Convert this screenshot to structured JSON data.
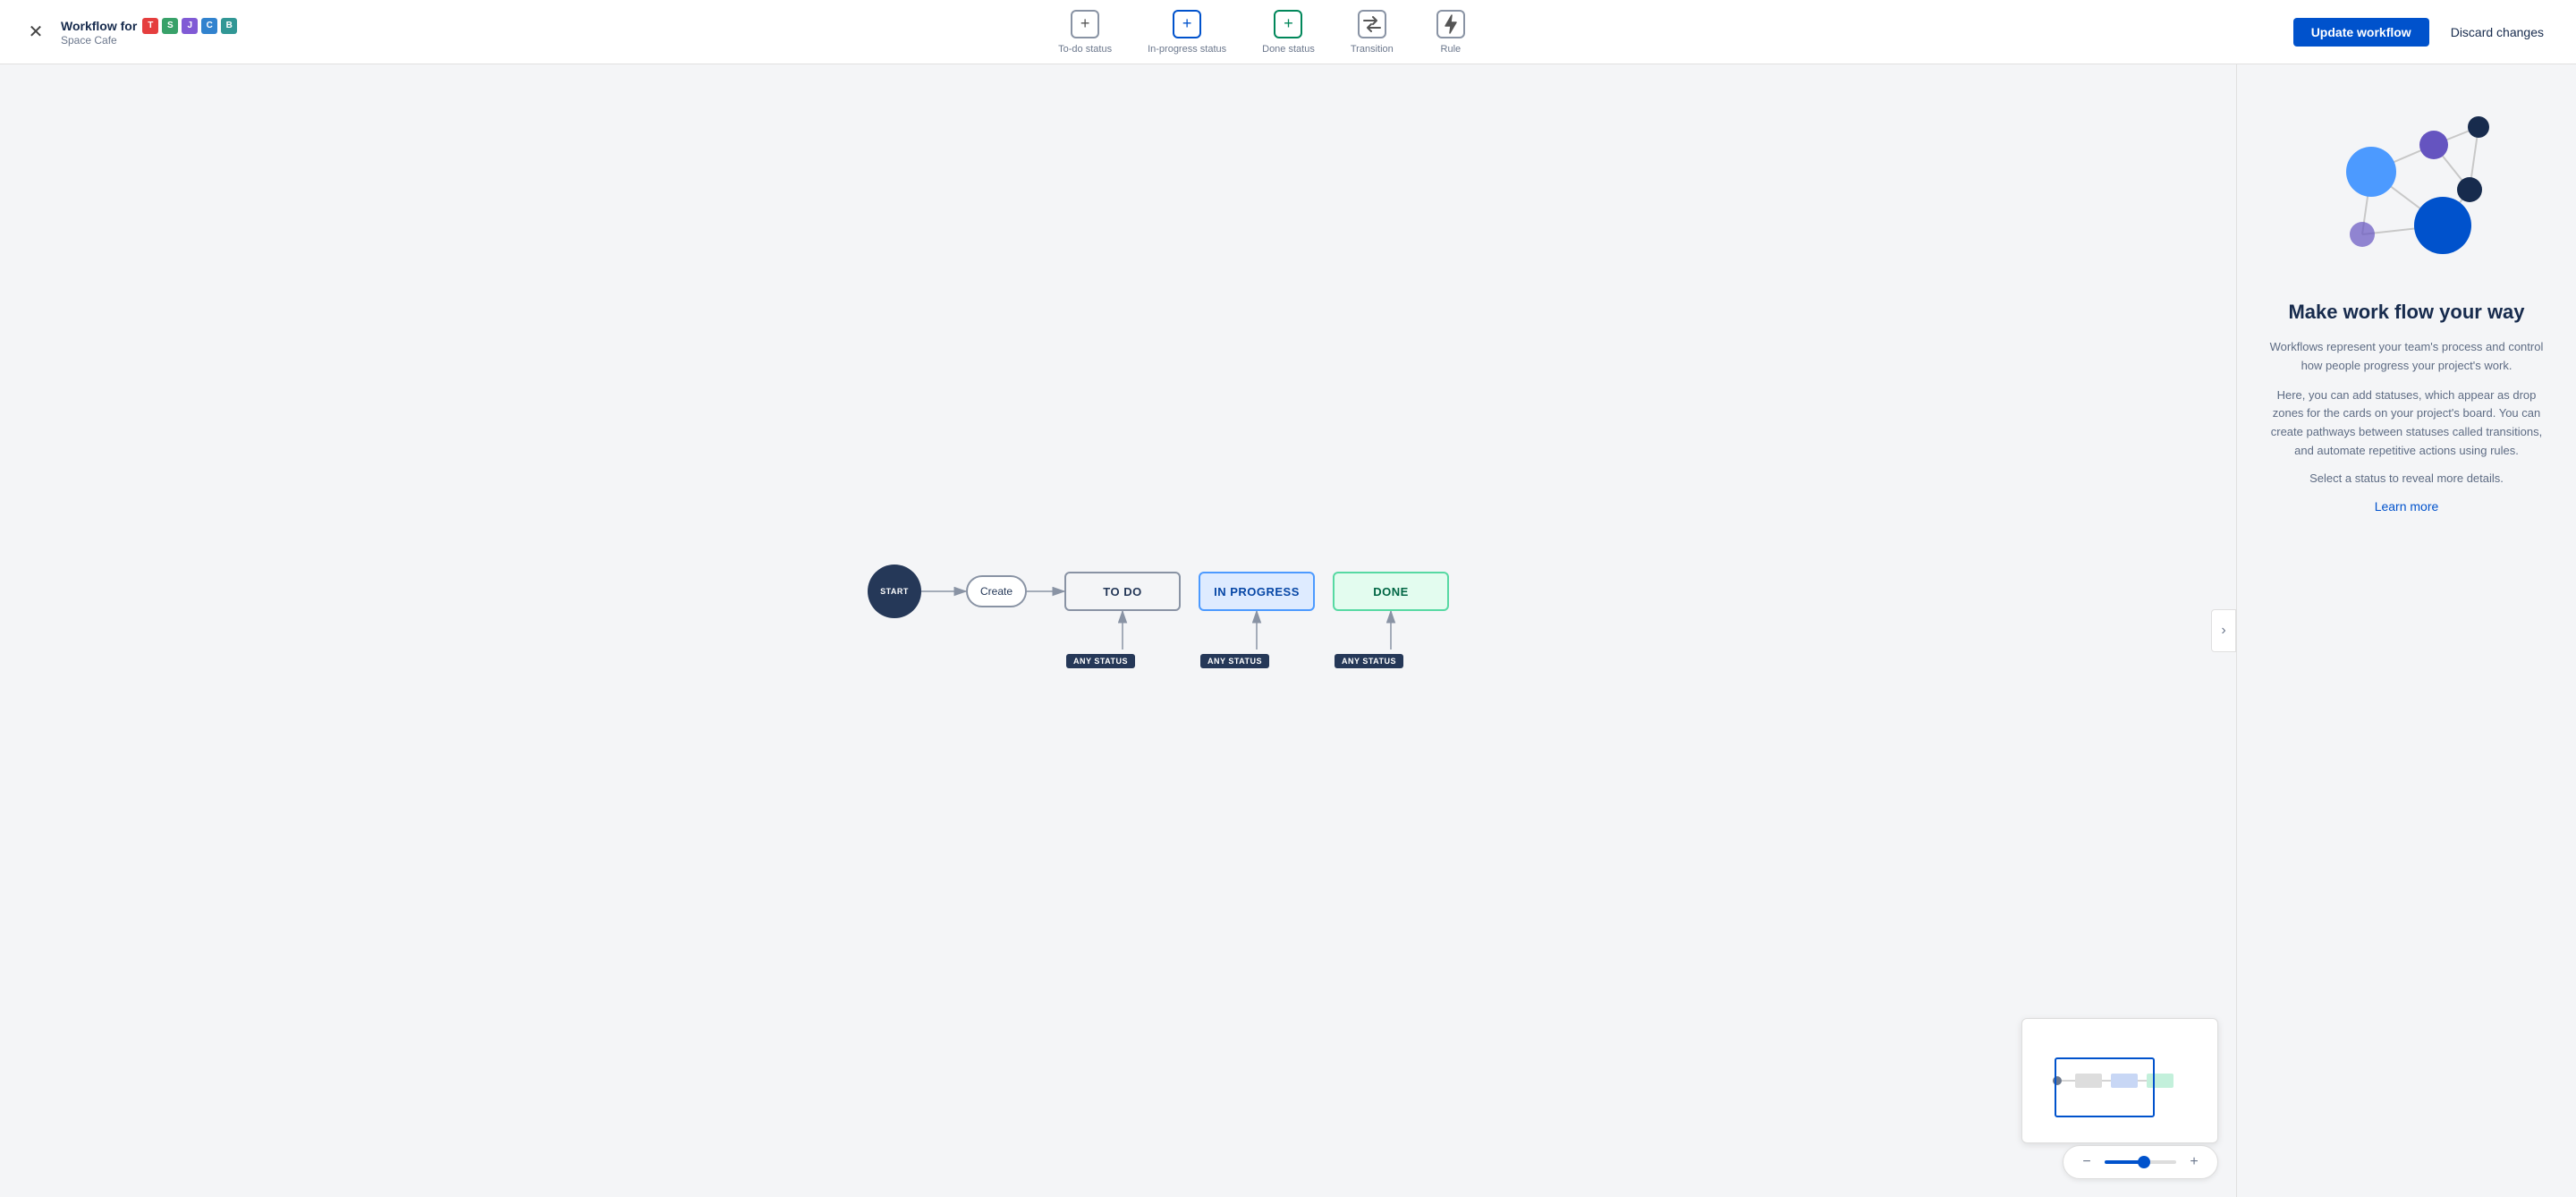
{
  "header": {
    "close_label": "✕",
    "workflow_for_label": "Workflow for",
    "project_name": "Space Cafe",
    "app_icons": [
      {
        "color": "#e53e3e",
        "letter": "T"
      },
      {
        "color": "#38a169",
        "letter": "S"
      },
      {
        "color": "#805ad5",
        "letter": "J"
      },
      {
        "color": "#3182ce",
        "letter": "C"
      },
      {
        "color": "#319795",
        "letter": "B"
      }
    ],
    "update_btn": "Update workflow",
    "discard_btn": "Discard changes"
  },
  "toolbar": {
    "items": [
      {
        "id": "todo-status",
        "label": "To-do status",
        "icon": "+",
        "border": "gray"
      },
      {
        "id": "inprogress-status",
        "label": "In-progress status",
        "icon": "+",
        "border": "blue"
      },
      {
        "id": "done-status",
        "label": "Done status",
        "icon": "+",
        "border": "green"
      },
      {
        "id": "transition",
        "label": "Transition",
        "icon": "⇄",
        "border": "gray"
      },
      {
        "id": "rule",
        "label": "Rule",
        "icon": "⚡",
        "border": "gray"
      }
    ]
  },
  "diagram": {
    "start_label": "START",
    "create_label": "Create",
    "nodes": [
      {
        "id": "todo",
        "label": "TO DO",
        "type": "todo"
      },
      {
        "id": "inprogress",
        "label": "IN PROGRESS",
        "type": "inprogress"
      },
      {
        "id": "done",
        "label": "DONE",
        "type": "done"
      }
    ],
    "any_status_label": "ANY STATUS"
  },
  "right_panel": {
    "title": "Make work flow your way",
    "description_1": "Workflows represent your team's process and control how people progress your project's work.",
    "description_2": "Here, you can add statuses, which appear as drop zones for the cards on your project's board. You can create pathways between statuses called transitions, and automate repetitive actions using rules.",
    "select_hint": "Select a status to reveal more details.",
    "learn_more": "Learn more"
  },
  "zoom": {
    "minus_icon": "−",
    "plus_icon": "+"
  },
  "collapse_icon": "›"
}
